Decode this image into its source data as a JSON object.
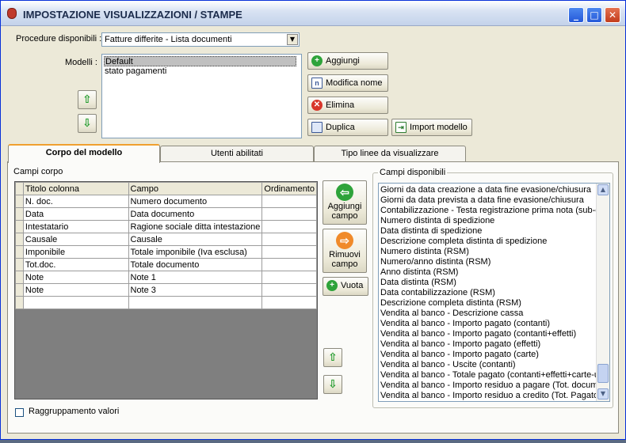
{
  "window": {
    "title": "IMPOSTAZIONE VISUALIZZAZIONI / STAMPE"
  },
  "top": {
    "procedure_label": "Procedure disponibili :",
    "procedure_value": "Fatture differite - Lista documenti",
    "modelli_label": "Modelli :",
    "modelli": [
      "Default",
      "stato pagamenti"
    ],
    "buttons": {
      "aggiungi": "Aggiungi",
      "modifica": "Modifica nome",
      "elimina": "Elimina",
      "duplica": "Duplica",
      "import": "Import modello"
    }
  },
  "tabs": [
    "Corpo del modello",
    "Utenti abilitati",
    "Tipo linee da visualizzare"
  ],
  "corpo": {
    "campi_corpo_label": "Campi corpo",
    "columns": [
      "Titolo colonna",
      "Campo",
      "Ordinamento"
    ],
    "rows": [
      [
        "N. doc.",
        "Numero documento",
        ""
      ],
      [
        "Data",
        "Data documento",
        ""
      ],
      [
        "Intestatario",
        "Ragione sociale ditta intestazione",
        ""
      ],
      [
        "Causale",
        "Causale",
        ""
      ],
      [
        "Imponibile",
        "Totale imponibile (Iva esclusa)",
        ""
      ],
      [
        "Tot.doc.",
        "Totale documento",
        ""
      ],
      [
        "Note",
        "Note 1",
        ""
      ],
      [
        "Note",
        "Note 3",
        ""
      ],
      [
        "",
        "",
        ""
      ]
    ],
    "aggiungi_campo": "Aggiungi campo",
    "rimuovi_campo": "Rimuovi campo",
    "vuota": "Vuota",
    "raggruppamento": "Raggruppamento valori",
    "campi_disponibili_label": "Campi disponibili",
    "campi_disponibili": [
      "Giorni da data creazione a data fine evasione/chiusura",
      "Giorni da data prevista a data fine evasione/chiusura",
      "Contabilizzazione - Testa registrazione prima nota (sub-opz",
      "Numero distinta di spedizione",
      "Data distinta di spedizione",
      "Descrizione completa distinta di spedizione",
      "Numero distinta (RSM)",
      "Numero/anno distinta (RSM)",
      "Anno distinta (RSM)",
      "Data distinta (RSM)",
      "Data contabilizzazione (RSM)",
      "Descrizione completa distinta (RSM)",
      "Vendita al banco - Descrizione cassa",
      "Vendita al banco - Importo pagato (contanti)",
      "Vendita al banco - Importo pagato (contanti+effetti)",
      "Vendita al banco - Importo pagato (effetti)",
      "Vendita al banco - Importo pagato (carte)",
      "Vendita al banco - Uscite (contanti)",
      "Vendita al banco - Totale pagato (contanti+effetti+carte-u",
      "Vendita al banco - Importo residuo a pagare (Tot. docume",
      "Vendita al banco - Importo residuo a credito (Tot. Pagato -"
    ]
  }
}
